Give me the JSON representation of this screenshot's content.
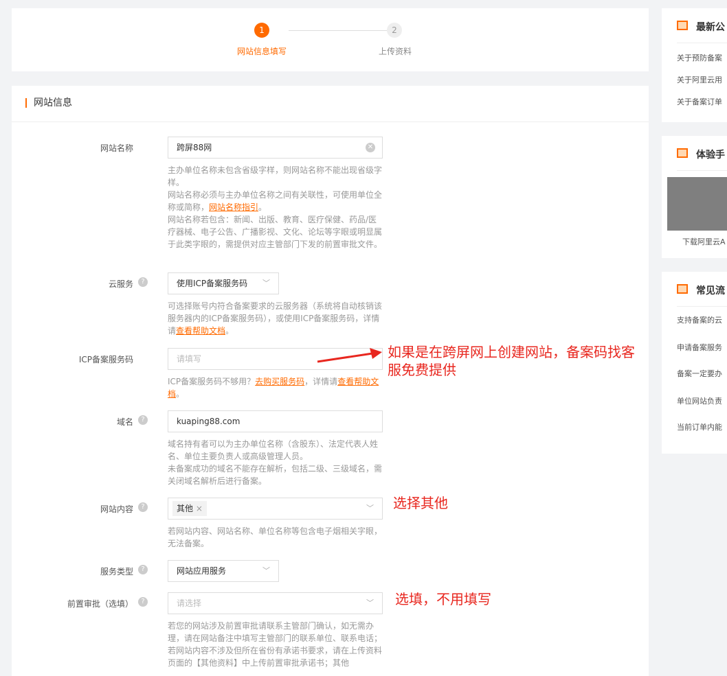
{
  "steps": [
    {
      "num": "1",
      "label": "网站信息填写",
      "active": true
    },
    {
      "num": "2",
      "label": "上传资料",
      "active": false
    }
  ],
  "section_title": "网站信息",
  "fields": {
    "site_name": {
      "label": "网站名称",
      "value": "跨屏88网",
      "help1": "主办单位名称未包含省级字样，则网站名称不能出现省级字样。",
      "help2": "网站名称必须与主办单位名称之间有关联性，可使用单位全称或简称，",
      "help2_link": "网站名称指引",
      "help3": "网站名称若包含：新闻、出版、教育、医疗保健、药品/医疗器械、电子公告、广播影视、文化、论坛等字眼或明显属于此类字眼的，需提供对应主管部门下发的前置审批文件。"
    },
    "cloud": {
      "label": "云服务",
      "value": "使用ICP备案服务码",
      "help": "可选择账号内符合备案要求的云服务器（系统将自动核销该服务器内的ICP备案服务码），或使用ICP备案服务码，详情请",
      "help_link": "查看帮助文档"
    },
    "icp_code": {
      "label": "ICP备案服务码",
      "placeholder": "请填写",
      "help": "ICP备案服务码不够用？",
      "help_link1": "去购买服务码",
      "help_mid": "，详情请",
      "help_link2": "查看帮助文档"
    },
    "domain": {
      "label": "域名",
      "value": "kuaping88.com",
      "help1": "域名持有者可以为主办单位名称（含股东）、法定代表人姓名、单位主要负责人或高级管理人员。",
      "help2": "未备案成功的域名不能存在解析，包括二级、三级域名，需关闭域名解析后进行备案。"
    },
    "content": {
      "label": "网站内容",
      "tag": "其他",
      "help": "若网站内容、网站名称、单位名称等包含电子烟相关字眼，无法备案。"
    },
    "service_type": {
      "label": "服务类型",
      "value": "网站应用服务"
    },
    "pre_approval": {
      "label": "前置审批（选填）",
      "placeholder": "请选择",
      "help": "若您的网站涉及前置审批请联系主管部门确认，如无需办理，请在网站备注中填写主管部门的联系单位、联系电话；若网站内容不涉及但所在省份有承诺书要求，请在上传资料页面的【其他资料】中上传前置审批承诺书；其他"
    }
  },
  "annotations": {
    "icp": "如果是在跨屏网上创建网站，备案码找客服免费提供",
    "content": "选择其他",
    "pre": "选填，不用填写"
  },
  "sidebar": {
    "notice": {
      "title": "最新公",
      "items": [
        "关于预防备案",
        "关于阿里云用",
        "关于备案订单"
      ]
    },
    "experience": {
      "title": "体验手",
      "caption": "下载阿里云A"
    },
    "faq": {
      "title": "常见流",
      "items": [
        "支持备案的云",
        "申请备案服务",
        "备案一定要办",
        "单位网站负责",
        "当前订单内能"
      ]
    }
  }
}
